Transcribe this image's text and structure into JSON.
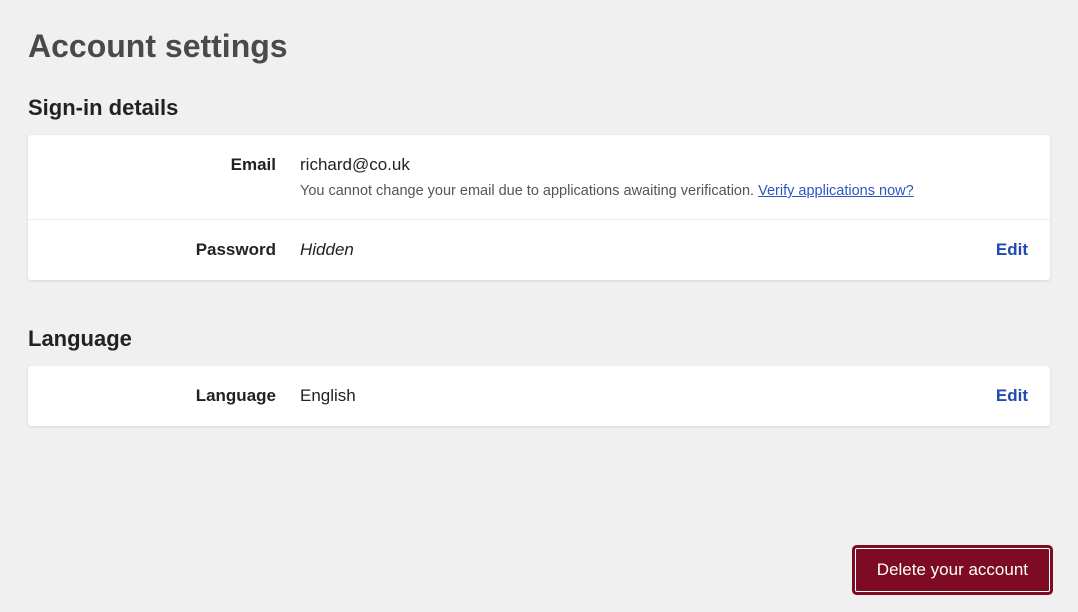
{
  "page_title": "Account settings",
  "signin_section": {
    "title": "Sign-in details",
    "email": {
      "label": "Email",
      "value": "richard@co.uk",
      "help_prefix": "You cannot change your email due to applications awaiting verification. ",
      "help_link_text": "Verify applications now?"
    },
    "password": {
      "label": "Password",
      "value": "Hidden",
      "edit_label": "Edit"
    }
  },
  "language_section": {
    "title": "Language",
    "language": {
      "label": "Language",
      "value": "English",
      "edit_label": "Edit"
    }
  },
  "delete_button_label": "Delete your account"
}
